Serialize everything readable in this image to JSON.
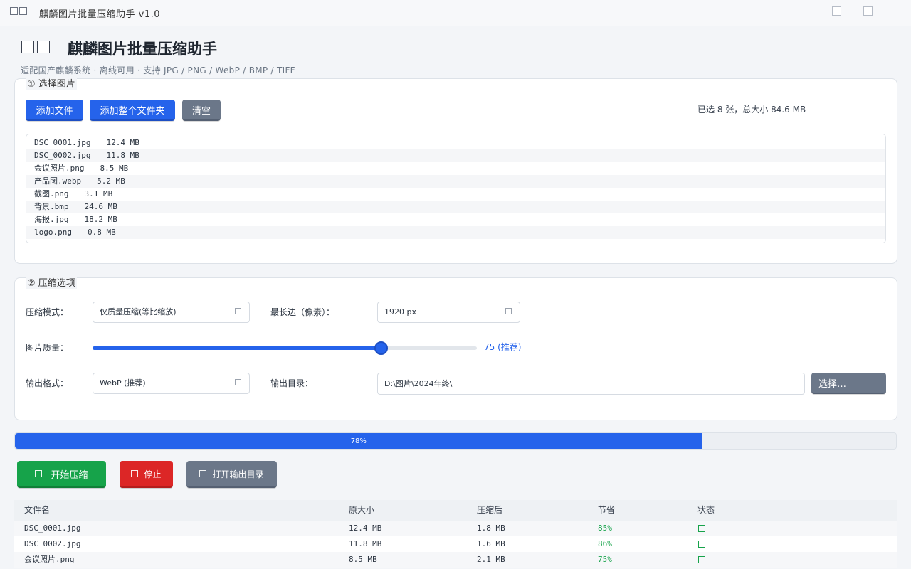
{
  "window": {
    "title": "麒麟图片批量压缩助手 v1.0"
  },
  "header": {
    "title": "麒麟图片批量压缩助手",
    "subtitle": "适配国产麒麟系统 · 离线可用 · 支持 JPG / PNG / WebP / BMP / TIFF"
  },
  "select_panel": {
    "legend": "① 选择图片",
    "add_files": "添加文件",
    "add_folder": "添加整个文件夹",
    "clear": "清空",
    "summary": "已选 8 张，总大小 84.6 MB",
    "files": [
      {
        "name": "DSC_0001.jpg",
        "size": "12.4 MB"
      },
      {
        "name": "DSC_0002.jpg",
        "size": "11.8 MB"
      },
      {
        "name": "会议照片.png",
        "size": "8.5 MB"
      },
      {
        "name": "产品图.webp",
        "size": "5.2 MB"
      },
      {
        "name": "截图.png",
        "size": "3.1 MB"
      },
      {
        "name": "背景.bmp",
        "size": "24.6 MB"
      },
      {
        "name": "海报.jpg",
        "size": "18.2 MB"
      },
      {
        "name": "logo.png",
        "size": "0.8 MB"
      }
    ]
  },
  "options_panel": {
    "legend": "② 压缩选项",
    "mode_label": "压缩模式：",
    "mode_value": "仅质量压缩(等比缩放)",
    "maxedge_label": "最长边（像素）：",
    "maxedge_value": "1920 px",
    "quality_label": "图片质量：",
    "quality": 75,
    "quality_min": 0,
    "quality_max": 100,
    "quality_text": "75 (推荐)",
    "format_label": "输出格式：",
    "format_value": "WebP (推荐)",
    "outdir_label": "输出目录：",
    "outdir_value": "D:\\图片\\2024年终\\",
    "choose": "选择…"
  },
  "progress": {
    "percent": 78,
    "text": "78%"
  },
  "actions": {
    "start": "开始压缩",
    "stop": "停止",
    "open_output": "打开输出目录"
  },
  "results": {
    "headers": [
      "文件名",
      "原大小",
      "压缩后",
      "节省",
      "状态"
    ],
    "rows": [
      {
        "name": "DSC_0001.jpg",
        "orig": "12.4 MB",
        "after": "1.8 MB",
        "save": "85%"
      },
      {
        "name": "DSC_0002.jpg",
        "orig": "11.8 MB",
        "after": "1.6 MB",
        "save": "86%"
      },
      {
        "name": "会议照片.png",
        "orig": "8.5 MB",
        "after": "2.1 MB",
        "save": "75%"
      }
    ]
  },
  "colors": {
    "accent": "#2563eb",
    "success": "#16a34a",
    "danger": "#dc2626",
    "neutral_button": "#6b7789"
  }
}
